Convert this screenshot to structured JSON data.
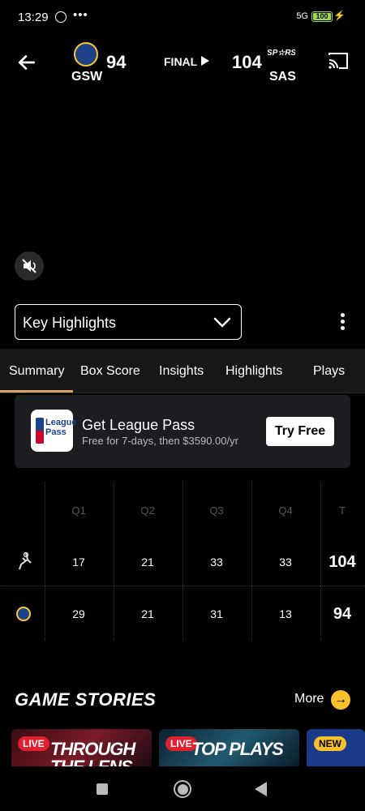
{
  "status_bar": {
    "time": "13:29",
    "dots": "•••",
    "network": "5G",
    "battery": "100"
  },
  "header": {
    "away": {
      "abbr": "GSW",
      "score": "94"
    },
    "home": {
      "abbr": "SAS",
      "score": "104"
    },
    "status": "FINAL"
  },
  "video": {
    "selector": "Key Highlights"
  },
  "tabs": [
    "Summary",
    "Box Score",
    "Insights",
    "Highlights",
    "Plays"
  ],
  "promo": {
    "logo_text": "League Pass",
    "title": "Get League Pass",
    "subtitle": "Free for 7-days, then $3590.00/yr",
    "button": "Try Free"
  },
  "linescore": {
    "headers": [
      "Q1",
      "Q2",
      "Q3",
      "Q4",
      "T"
    ],
    "rows": [
      {
        "team": "SAS",
        "q": [
          "17",
          "21",
          "33",
          "33"
        ],
        "total": "104"
      },
      {
        "team": "GSW",
        "q": [
          "29",
          "21",
          "31",
          "13"
        ],
        "total": "94"
      }
    ]
  },
  "stories": {
    "title": "GAME STORIES",
    "more": "More",
    "cards": [
      {
        "badge": "LIVE",
        "text": "THROUGH THE LENS"
      },
      {
        "badge": "LIVE",
        "text": "TOP PLAYS"
      },
      {
        "badge": "NEW",
        "text": ""
      }
    ]
  },
  "colors": {
    "accent": "#d9a36b",
    "live": "#e0202f",
    "new": "#f7c02c",
    "warriors": "#1d428a"
  }
}
